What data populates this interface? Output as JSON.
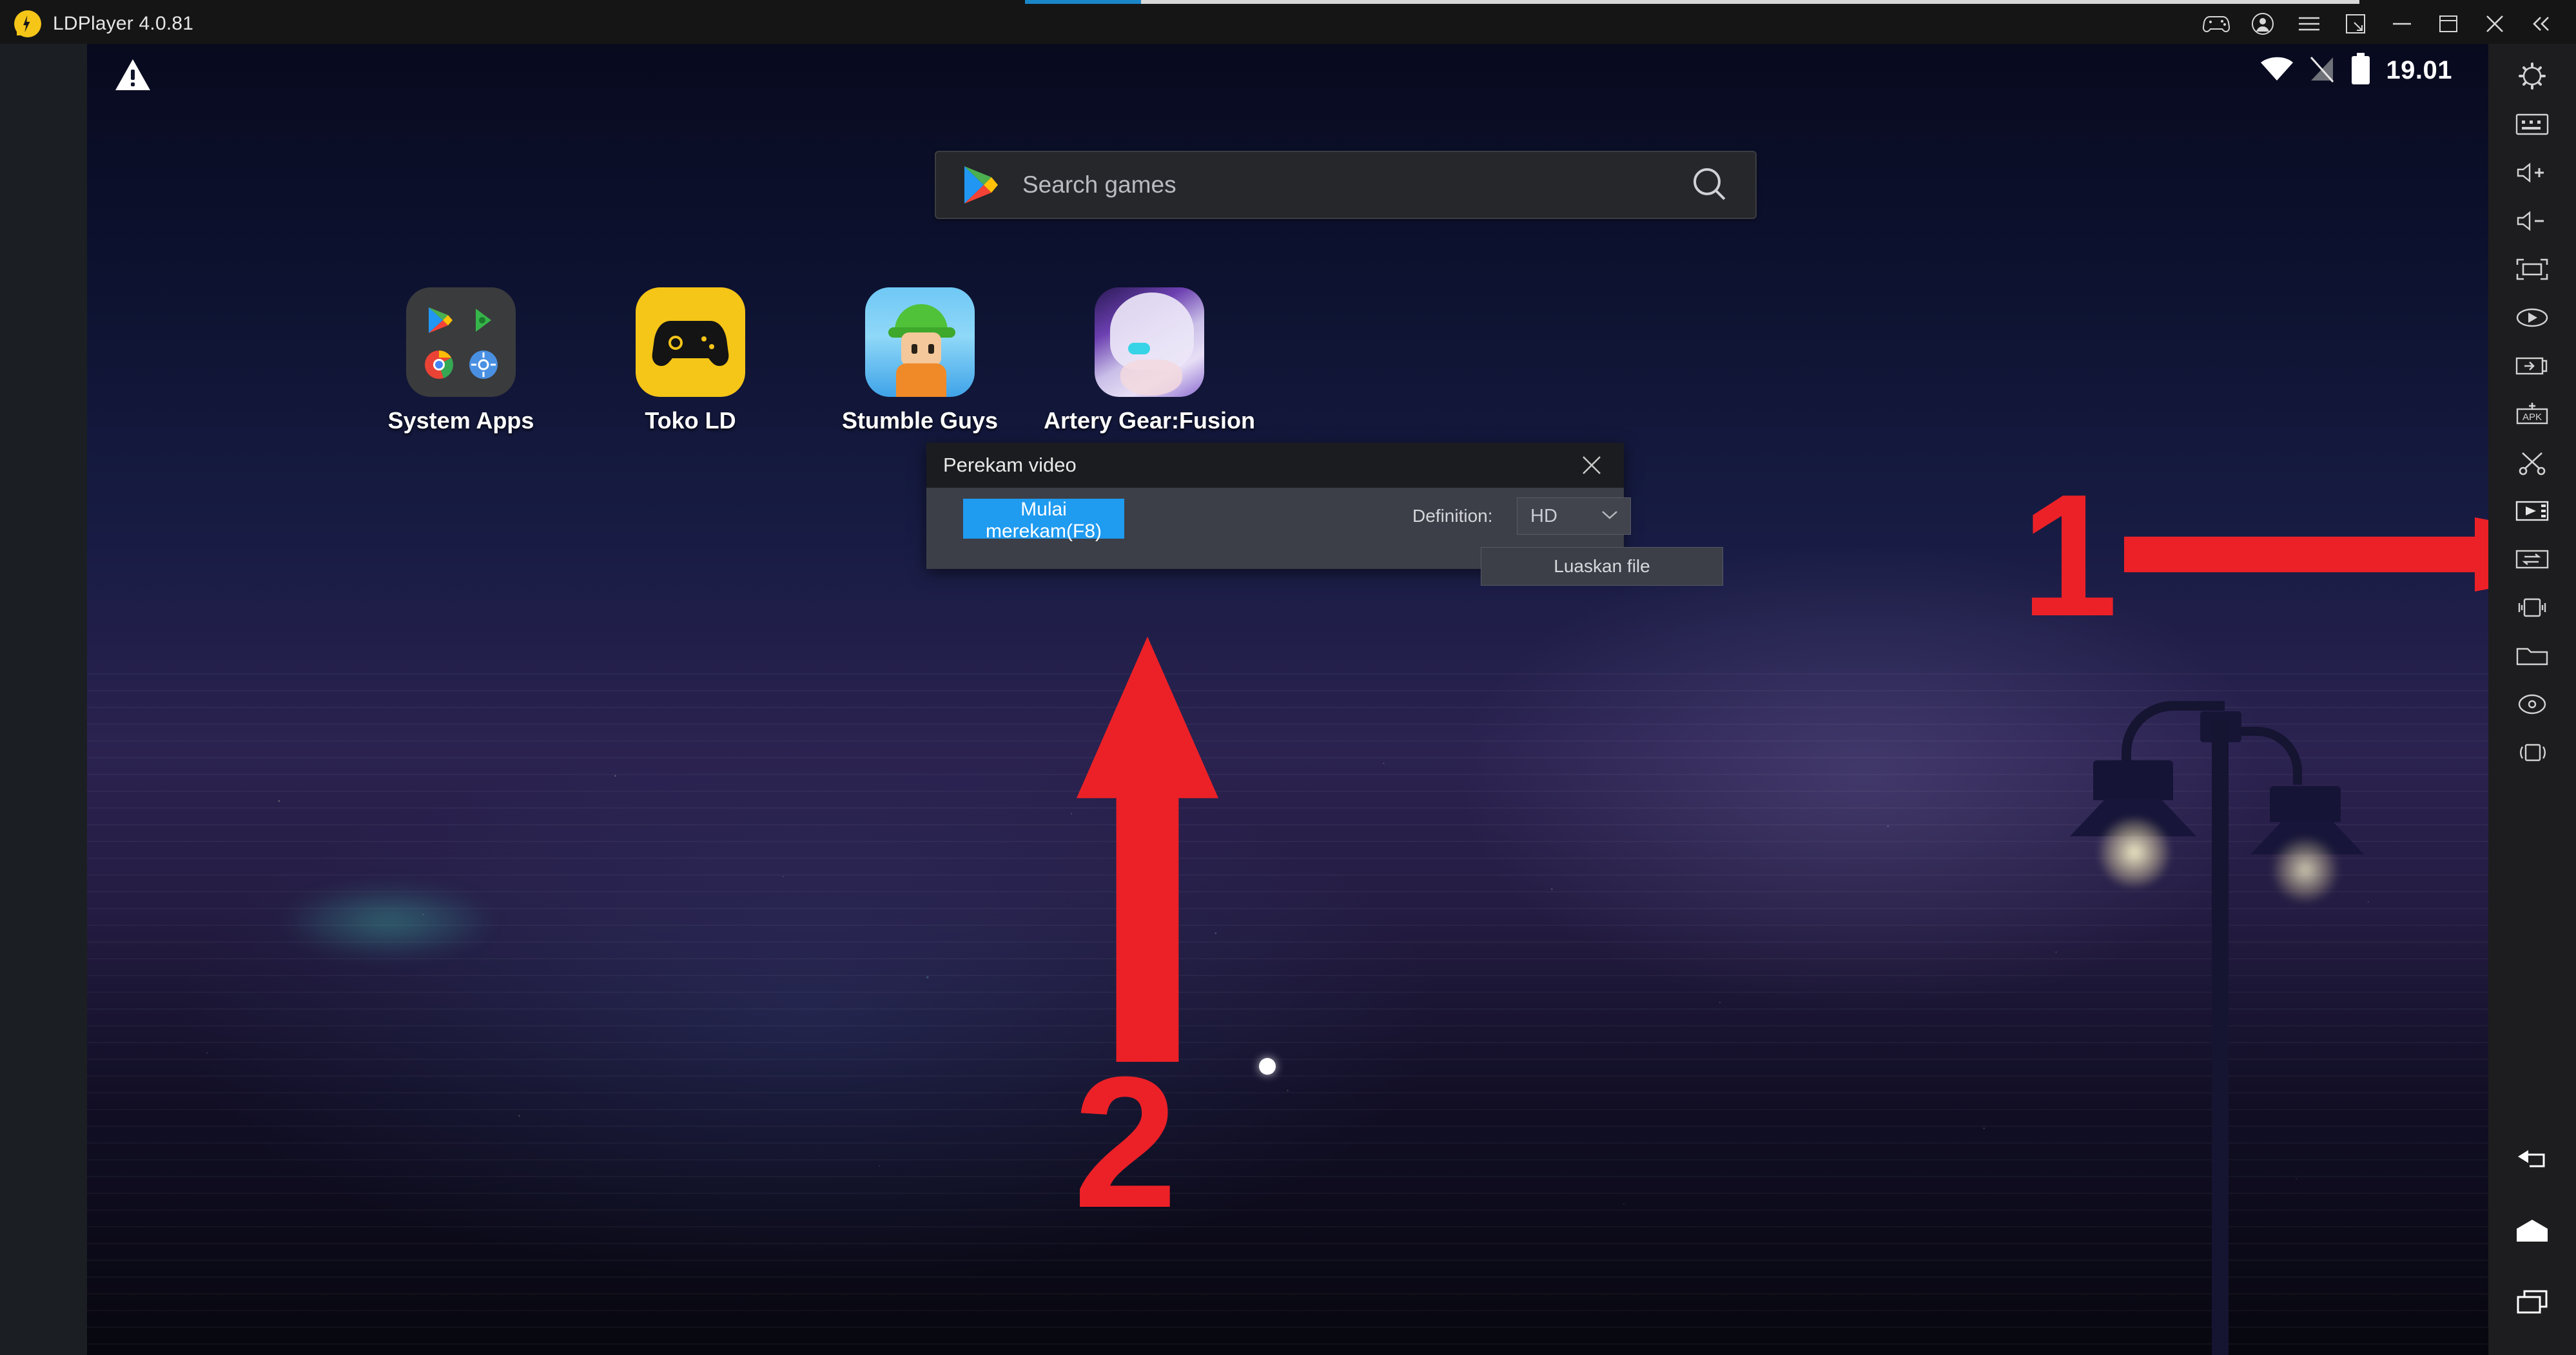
{
  "window": {
    "title": "LDPlayer 4.0.81",
    "logo_icon": "ldplayer-logo-icon",
    "controls": [
      {
        "name": "gamepad-icon",
        "label": "Gamepad"
      },
      {
        "name": "account-icon",
        "label": "Account"
      },
      {
        "name": "menu-icon",
        "label": "Menu"
      },
      {
        "name": "resize-icon",
        "label": "Resize"
      },
      {
        "name": "minimize-icon",
        "label": "Minimize"
      },
      {
        "name": "maximize-icon",
        "label": "Maximize"
      },
      {
        "name": "close-icon",
        "label": "Close"
      },
      {
        "name": "collapse-chevrons-icon",
        "label": "Collapse"
      }
    ]
  },
  "statusbar": {
    "warning_icon": "warning-triangle-icon",
    "wifi_icon": "wifi-icon",
    "signal_off_icon": "signal-off-icon",
    "battery_icon": "battery-full-icon",
    "clock": "19.01"
  },
  "search": {
    "placeholder": "Search games",
    "store_icon": "google-play-icon",
    "search_icon": "search-icon"
  },
  "apps": [
    {
      "label": "System Apps",
      "icon": "system-apps-folder-icon"
    },
    {
      "label": "Toko LD",
      "icon": "toko-ld-icon"
    },
    {
      "label": "Stumble Guys",
      "icon": "stumble-guys-icon"
    },
    {
      "label": "Artery Gear:Fusion",
      "icon": "artery-gear-fusion-icon"
    }
  ],
  "dialog": {
    "title": "Perekam video",
    "close_icon": "close-icon",
    "start_button": "Mulai merekam(F8)",
    "definition_label": "Definition:",
    "definition_value": "HD",
    "definition_options": [
      "HD"
    ],
    "open_file_button": "Luaskan file",
    "accent_color": "#1f9bf0"
  },
  "annotations": {
    "step1": "1",
    "step2": "2",
    "color": "#ec2127"
  },
  "sidebar": {
    "items": [
      {
        "name": "settings-gear-icon",
        "label": "Settings"
      },
      {
        "name": "keyboard-icon",
        "label": "Keyboard"
      },
      {
        "name": "volume-up-icon",
        "label": "Volume up"
      },
      {
        "name": "volume-down-icon",
        "label": "Volume down"
      },
      {
        "name": "fullscreen-icon",
        "label": "Fullscreen"
      },
      {
        "name": "rotate-icon",
        "label": "Rotate"
      },
      {
        "name": "screenshot-icon",
        "label": "Screenshot"
      },
      {
        "name": "install-apk-icon",
        "label": "Install APK"
      },
      {
        "name": "scissors-icon",
        "label": "Cut"
      },
      {
        "name": "video-recorder-icon",
        "label": "Perekam video"
      },
      {
        "name": "transfer-icon",
        "label": "Transfer"
      },
      {
        "name": "shake-icon",
        "label": "Shake"
      },
      {
        "name": "folder-icon",
        "label": "Shared folder"
      },
      {
        "name": "location-icon",
        "label": "Location"
      },
      {
        "name": "multi-window-icon",
        "label": "Multi window"
      }
    ],
    "nav": [
      {
        "name": "back-icon",
        "label": "Back"
      },
      {
        "name": "home-icon",
        "label": "Home"
      },
      {
        "name": "recents-icon",
        "label": "Recents"
      }
    ]
  }
}
